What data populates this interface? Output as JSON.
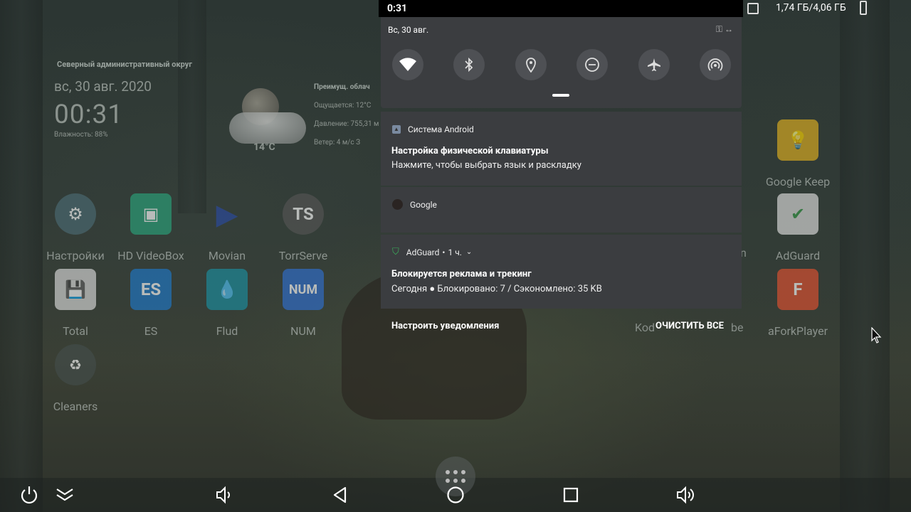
{
  "status_bar": {
    "time": "0:31",
    "memory": "1,74 ГБ/4,06 ГБ"
  },
  "quick_settings": {
    "date": "Вс, 30 авг.",
    "tiles": [
      {
        "name": "wifi-icon"
      },
      {
        "name": "bluetooth-icon"
      },
      {
        "name": "location-icon"
      },
      {
        "name": "do-not-disturb-icon"
      },
      {
        "name": "airplane-mode-icon"
      },
      {
        "name": "hotspot-icon"
      }
    ]
  },
  "notifications": [
    {
      "app": "Система Android",
      "title": "Настройка физической клавиатуры",
      "text": "Нажмите, чтобы выбрать язык и раскладку"
    },
    {
      "app": "Google"
    },
    {
      "app": "AdGuard",
      "time": "1 ч.",
      "title": "Блокируется реклама и трекинг",
      "text": "Сегодня ● Блокировано: 7 / Сэкономлено: 35 KB"
    }
  ],
  "notification_footer": {
    "settings": "Настроить уведомления",
    "clear_all": "ОЧИСТИТЬ ВСЕ"
  },
  "weather_widget": {
    "location": "Северный административный округ",
    "date": "вс, 30 авг. 2020",
    "time": "00:31",
    "humidity": "Влажность: 88%",
    "temperature": "14°C",
    "condition": "Преимущ. облач",
    "feels_like": "Ощущается: 12°C",
    "pressure": "Давление: 755,31 м",
    "wind": "Ветер: 4 м/с З"
  },
  "apps": [
    {
      "label": "Настройки",
      "color": "#4b6a73",
      "glyph": "⚙"
    },
    {
      "label": "HD VideoBox",
      "color": "#2aa37a",
      "glyph": "▣"
    },
    {
      "label": "Movian",
      "color": "#2a4aa0",
      "glyph": "▶"
    },
    {
      "label": "TorrServe",
      "color": "#4a4a4a",
      "glyph": "TS"
    },
    {
      "label": "Total",
      "color": "#d9d9d9",
      "glyph": "💾"
    },
    {
      "label": "ES",
      "color": "#1f78c8",
      "glyph": "ES"
    },
    {
      "label": "Flud",
      "color": "#1b8fa0",
      "glyph": "💧"
    },
    {
      "label": "NUM",
      "color": "#2f6fd0",
      "glyph": "NUM"
    },
    {
      "label": "Cleaners",
      "color": "#3a4a4a",
      "glyph": "♻"
    },
    {
      "label": "Google Keep",
      "color": "#e0b020",
      "glyph": "💡"
    },
    {
      "label": "AdGuard",
      "color": "#dddddd",
      "glyph": "✔"
    },
    {
      "label": "aForkPlayer",
      "color": "#e05030",
      "glyph": "F"
    }
  ],
  "partial_labels": {
    "kodi": "Kod",
    "youtube": "be",
    "hidden_n": "n"
  }
}
